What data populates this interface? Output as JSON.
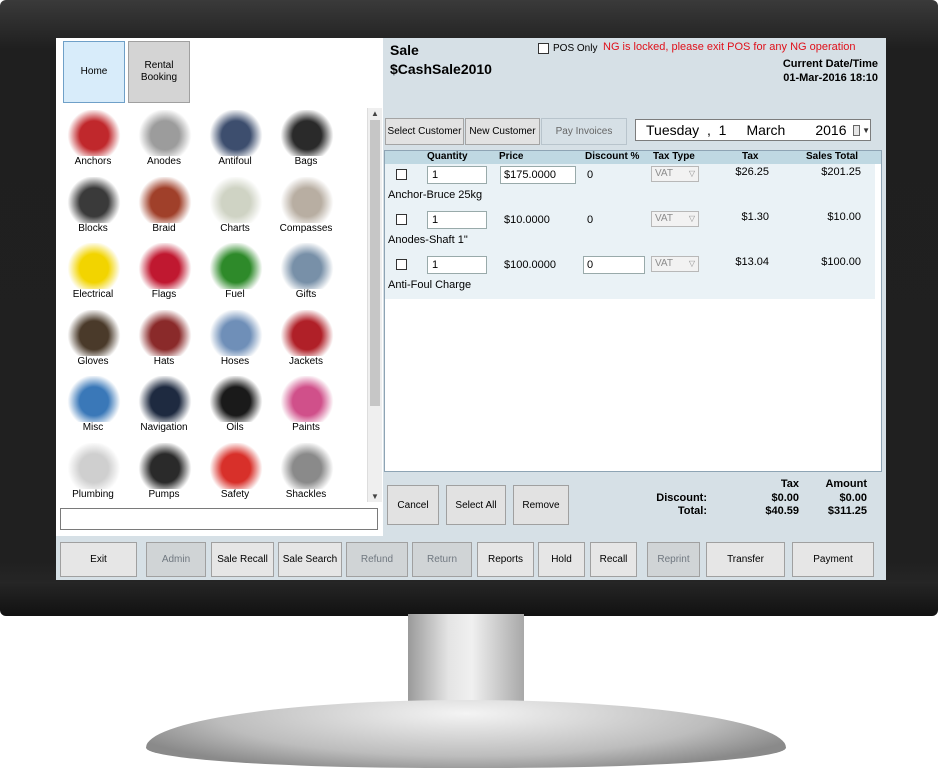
{
  "left_tabs": [
    {
      "label": "Home",
      "active": true
    },
    {
      "label": "Rental Booking",
      "active": false
    }
  ],
  "categories": [
    {
      "label": "Anchors",
      "icon": "anchor-icon",
      "color": "#c0282c"
    },
    {
      "label": "Anodes",
      "icon": "anode-icon",
      "color": "#9c9c9c"
    },
    {
      "label": "Antifoul",
      "icon": "boat-hull-icon",
      "color": "#3d4e6e"
    },
    {
      "label": "Bags",
      "icon": "bag-icon",
      "color": "#2a2a2a"
    },
    {
      "label": "Blocks",
      "icon": "block-pulley-icon",
      "color": "#3a3a3a"
    },
    {
      "label": "Braid",
      "icon": "rope-braid-icon",
      "color": "#a0402a"
    },
    {
      "label": "Charts",
      "icon": "chart-map-icon",
      "color": "#cfd3c4"
    },
    {
      "label": "Compasses",
      "icon": "compass-icon",
      "color": "#b8aea2"
    },
    {
      "label": "Electrical",
      "icon": "electrical-warning-icon",
      "color": "#f2d400"
    },
    {
      "label": "Flags",
      "icon": "flag-icon",
      "color": "#c01830"
    },
    {
      "label": "Fuel",
      "icon": "fuel-nozzle-icon",
      "color": "#2e8a2a"
    },
    {
      "label": "Gifts",
      "icon": "gift-icon",
      "color": "#7890a8"
    },
    {
      "label": "Gloves",
      "icon": "glove-icon",
      "color": "#4a3a2a"
    },
    {
      "label": "Hats",
      "icon": "hat-icon",
      "color": "#8a2a2a"
    },
    {
      "label": "Hoses",
      "icon": "hose-icon",
      "color": "#6f8fb8"
    },
    {
      "label": "Jackets",
      "icon": "jacket-icon",
      "color": "#b02028"
    },
    {
      "label": "Misc",
      "icon": "misc-folder-icon",
      "color": "#3a78b8"
    },
    {
      "label": "Navigation",
      "icon": "navigation-icon",
      "color": "#1e2a40"
    },
    {
      "label": "Oils",
      "icon": "oil-can-icon",
      "color": "#1a1a1a"
    },
    {
      "label": "Paints",
      "icon": "paint-brush-icon",
      "color": "#d0508a"
    },
    {
      "label": "Plumbing",
      "icon": "plumbing-icon",
      "color": "#cfcfcf"
    },
    {
      "label": "Pumps",
      "icon": "pump-icon",
      "color": "#2a2a2a"
    },
    {
      "label": "Safety",
      "icon": "lifebuoy-icon",
      "color": "#d8302a"
    },
    {
      "label": "Shackles",
      "icon": "shackle-icon",
      "color": "#8a8a8a"
    }
  ],
  "header": {
    "title": "Sale",
    "sale_number": "$CashSale2010",
    "pos_only_label": "POS Only",
    "ng_message": "NG is locked, please exit POS for any NG operation",
    "current_date_label": "Current Date/Time",
    "current_date_value": "01-Mar-2016 18:10"
  },
  "customer_buttons": {
    "select": "Select Customer",
    "new": "New Customer",
    "pay_invoices": "Pay Invoices"
  },
  "date_picker": {
    "weekday": "Tuesday",
    "day": "1",
    "month": "March",
    "year": "2016"
  },
  "grid": {
    "columns": [
      "Quantity",
      "Price",
      "Discount %",
      "Tax Type",
      "Tax",
      "Sales Total"
    ],
    "rows": [
      {
        "qty": "1",
        "price": "$175.0000",
        "discount": "0",
        "tax_type": "VAT",
        "tax": "$26.25",
        "total": "$201.25",
        "description": "Anchor-Bruce 25kg"
      },
      {
        "qty": "1",
        "price": "$10.0000",
        "discount": "0",
        "tax_type": "VAT",
        "tax": "$1.30",
        "total": "$10.00",
        "description": "Anodes-Shaft 1\""
      },
      {
        "qty": "1",
        "price": "$100.0000",
        "discount": "0",
        "tax_type": "VAT",
        "tax": "$13.04",
        "total": "$100.00",
        "description": "Anti-Foul Charge"
      }
    ]
  },
  "grid_actions": {
    "cancel": "Cancel",
    "select_all": "Select All",
    "remove": "Remove"
  },
  "summary": {
    "tax_header": "Tax",
    "amount_header": "Amount",
    "discount_label": "Discount:",
    "total_label": "Total:",
    "discount_tax": "$0.00",
    "discount_amount": "$0.00",
    "total_tax": "$40.59",
    "total_amount": "$311.25"
  },
  "footer_buttons": [
    {
      "label": "Exit",
      "enabled": true
    },
    {
      "label": "Admin",
      "enabled": false
    },
    {
      "label": "Sale Recall",
      "enabled": true
    },
    {
      "label": "Sale Search",
      "enabled": true
    },
    {
      "label": "Refund",
      "enabled": false
    },
    {
      "label": "Return",
      "enabled": false
    },
    {
      "label": "Reports",
      "enabled": true
    },
    {
      "label": "Hold",
      "enabled": true
    },
    {
      "label": "Recall",
      "enabled": true
    },
    {
      "label": "Reprint",
      "enabled": false
    },
    {
      "label": "Transfer",
      "enabled": true
    },
    {
      "label": "Payment",
      "enabled": true
    }
  ],
  "colors": {
    "screen_bg": "#d6e0e6",
    "header_blue": "#bfd8e2",
    "warning_red": "#e0101a"
  }
}
